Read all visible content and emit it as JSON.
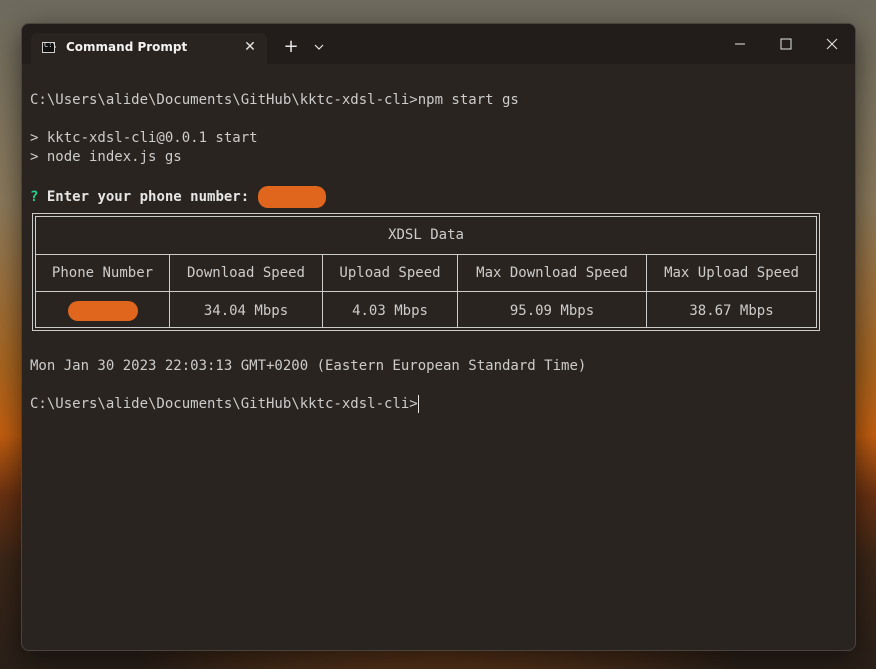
{
  "window": {
    "tab_title": "Command Prompt",
    "tab_close_glyph": "✕",
    "new_tab_glyph": "+",
    "tab_icon_glyph": "C:\\"
  },
  "colors": {
    "terminal_bg": "#2a2420",
    "titlebar_bg": "#221d1a",
    "text": "#cccccc",
    "prompt_mark": "#23d18b",
    "redaction": "#e0651d"
  },
  "icons": {
    "tab_icon": "command-prompt-icon",
    "close_tab": "close-icon",
    "new_tab": "plus-icon",
    "dropdown": "chevron-down-icon",
    "minimize": "minimize-icon",
    "maximize": "maximize-icon",
    "close": "close-icon"
  },
  "terminal": {
    "cmd1": "C:\\Users\\alide\\Documents\\GitHub\\kktc-xdsl-cli>npm start gs",
    "npm_line1": "> kktc-xdsl-cli@0.0.1 start",
    "npm_line2": "> node index.js gs",
    "question_mark": "?",
    "question_text": " Enter your phone number: ",
    "timestamp": "Mon Jan 30 2023 22:03:13 GMT+0200 (Eastern European Standard Time)",
    "prompt2": "C:\\Users\\alide\\Documents\\GitHub\\kktc-xdsl-cli>"
  },
  "table": {
    "title": "XDSL Data",
    "headers": [
      "Phone Number",
      "Download Speed",
      "Upload Speed",
      "Max Download Speed",
      "Max Upload Speed"
    ],
    "row": {
      "download": "34.04 Mbps",
      "upload": "4.03 Mbps",
      "max_download": "95.09 Mbps",
      "max_upload": "38.67 Mbps"
    }
  }
}
